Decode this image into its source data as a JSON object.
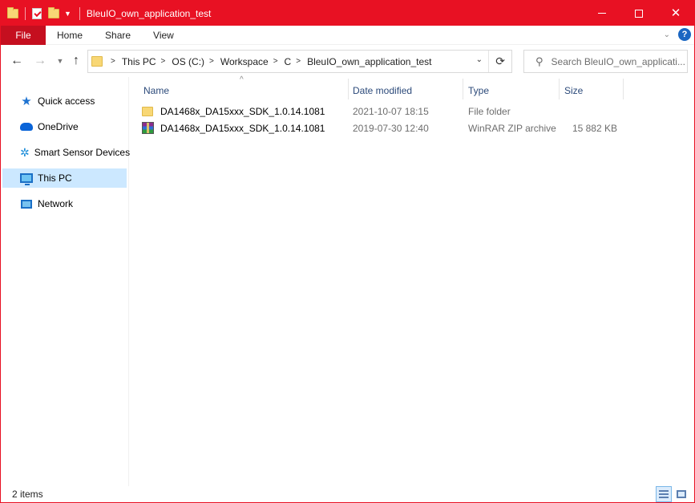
{
  "titlebar": {
    "title": "BleuIO_own_application_test",
    "controls": {
      "minimize": "minimize",
      "maximize": "maximize",
      "close": "✕"
    }
  },
  "ribbon": {
    "tabs": [
      "File",
      "Home",
      "Share",
      "View"
    ],
    "help": "?"
  },
  "nav": {
    "back": "←",
    "forward": "→",
    "recent": "⌄",
    "up": "↑"
  },
  "address": {
    "crumbs": [
      "This PC",
      "OS (C:)",
      "Workspace",
      "C",
      "BleuIO_own_application_test"
    ],
    "separator": ">"
  },
  "search": {
    "placeholder": "Search BleuIO_own_applicati..."
  },
  "sidebar": {
    "items": [
      {
        "label": "Quick access",
        "icon": "star-icon"
      },
      {
        "label": "OneDrive",
        "icon": "cloud-icon"
      },
      {
        "label": "Smart Sensor Devices",
        "icon": "sensor-icon"
      },
      {
        "label": "This PC",
        "icon": "computer-icon",
        "selected": true
      },
      {
        "label": "Network",
        "icon": "network-icon"
      }
    ]
  },
  "filelist": {
    "columns": [
      "Name",
      "Date modified",
      "Type",
      "Size"
    ],
    "rows": [
      {
        "name": "DA1468x_DA15xxx_SDK_1.0.14.1081",
        "date": "2021-10-07 18:15",
        "type": "File folder",
        "size": "",
        "icon": "folder-icon"
      },
      {
        "name": "DA1468x_DA15xxx_SDK_1.0.14.1081",
        "date": "2019-07-30 12:40",
        "type": "WinRAR ZIP archive",
        "size": "15 882 KB",
        "icon": "zip-archive-icon"
      }
    ]
  },
  "status": {
    "item_count": "2 items"
  },
  "colors": {
    "titlebar": "#e81123",
    "file_tab": "#c50f1f",
    "selection": "#cce8ff"
  }
}
